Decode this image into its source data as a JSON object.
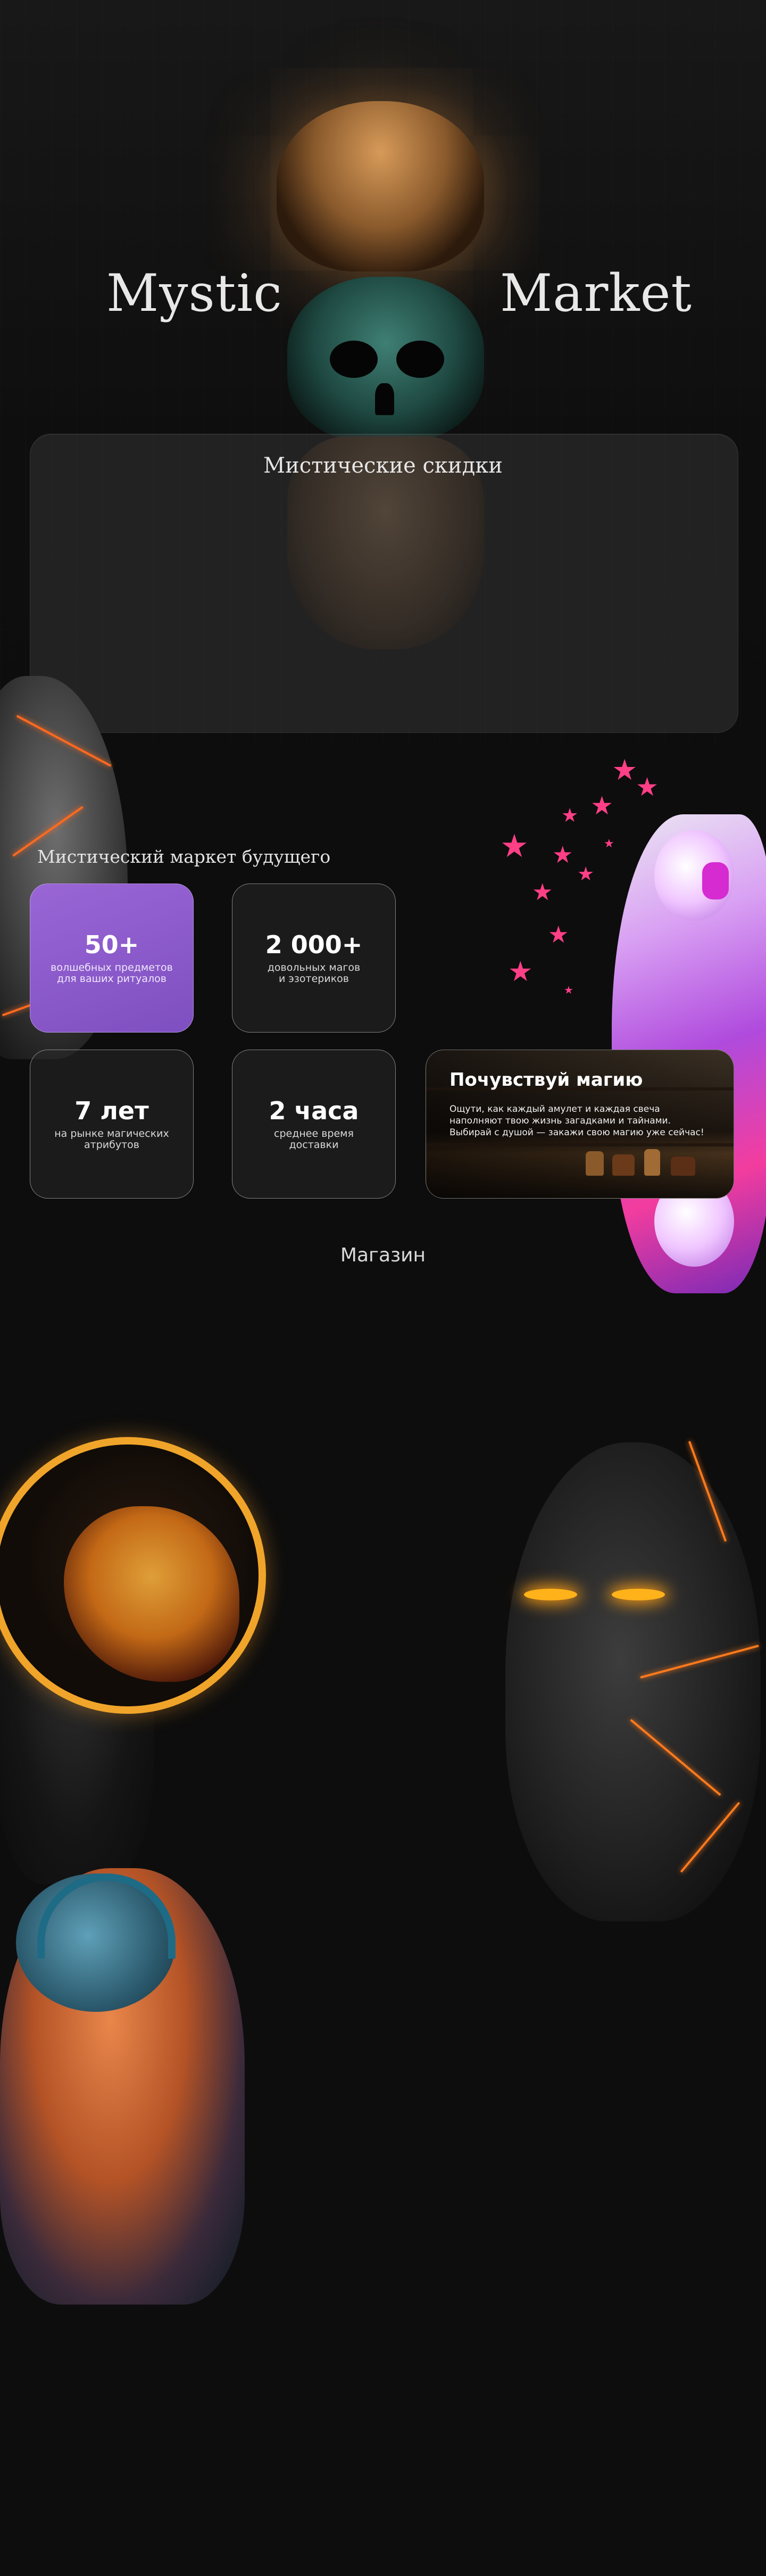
{
  "hero": {
    "title_left": "Mystic",
    "title_right": "Market",
    "discount_title": "Мистические скидки"
  },
  "features": {
    "heading": "Мистический маркет будущего",
    "stats": [
      {
        "value": "50+",
        "desc": "волшебных предметов\nдля ваших ритуалов"
      },
      {
        "value": "2 000+",
        "desc": "довольных магов\nи эзотериков"
      },
      {
        "value": "7 лет",
        "desc": "на рынке магических\nатрибутов"
      },
      {
        "value": "2 часа",
        "desc": "среднее время\nдоставки"
      }
    ],
    "promo": {
      "title": "Почувствуй магию",
      "text": "Ощути, как каждый амулет и каждая свеча\nнаполняют твою жизнь загадками и тайнами.\nВыбирай с душой — закажи свою магию уже сейчас!"
    }
  },
  "shop": {
    "heading": "Магазин"
  },
  "colors": {
    "background": "#0d0d0d",
    "accent_purple": "#8a58c9",
    "star_pink": "#ff3f86",
    "lava_orange": "#ff6a1f"
  },
  "icons": [
    "star-icon"
  ]
}
